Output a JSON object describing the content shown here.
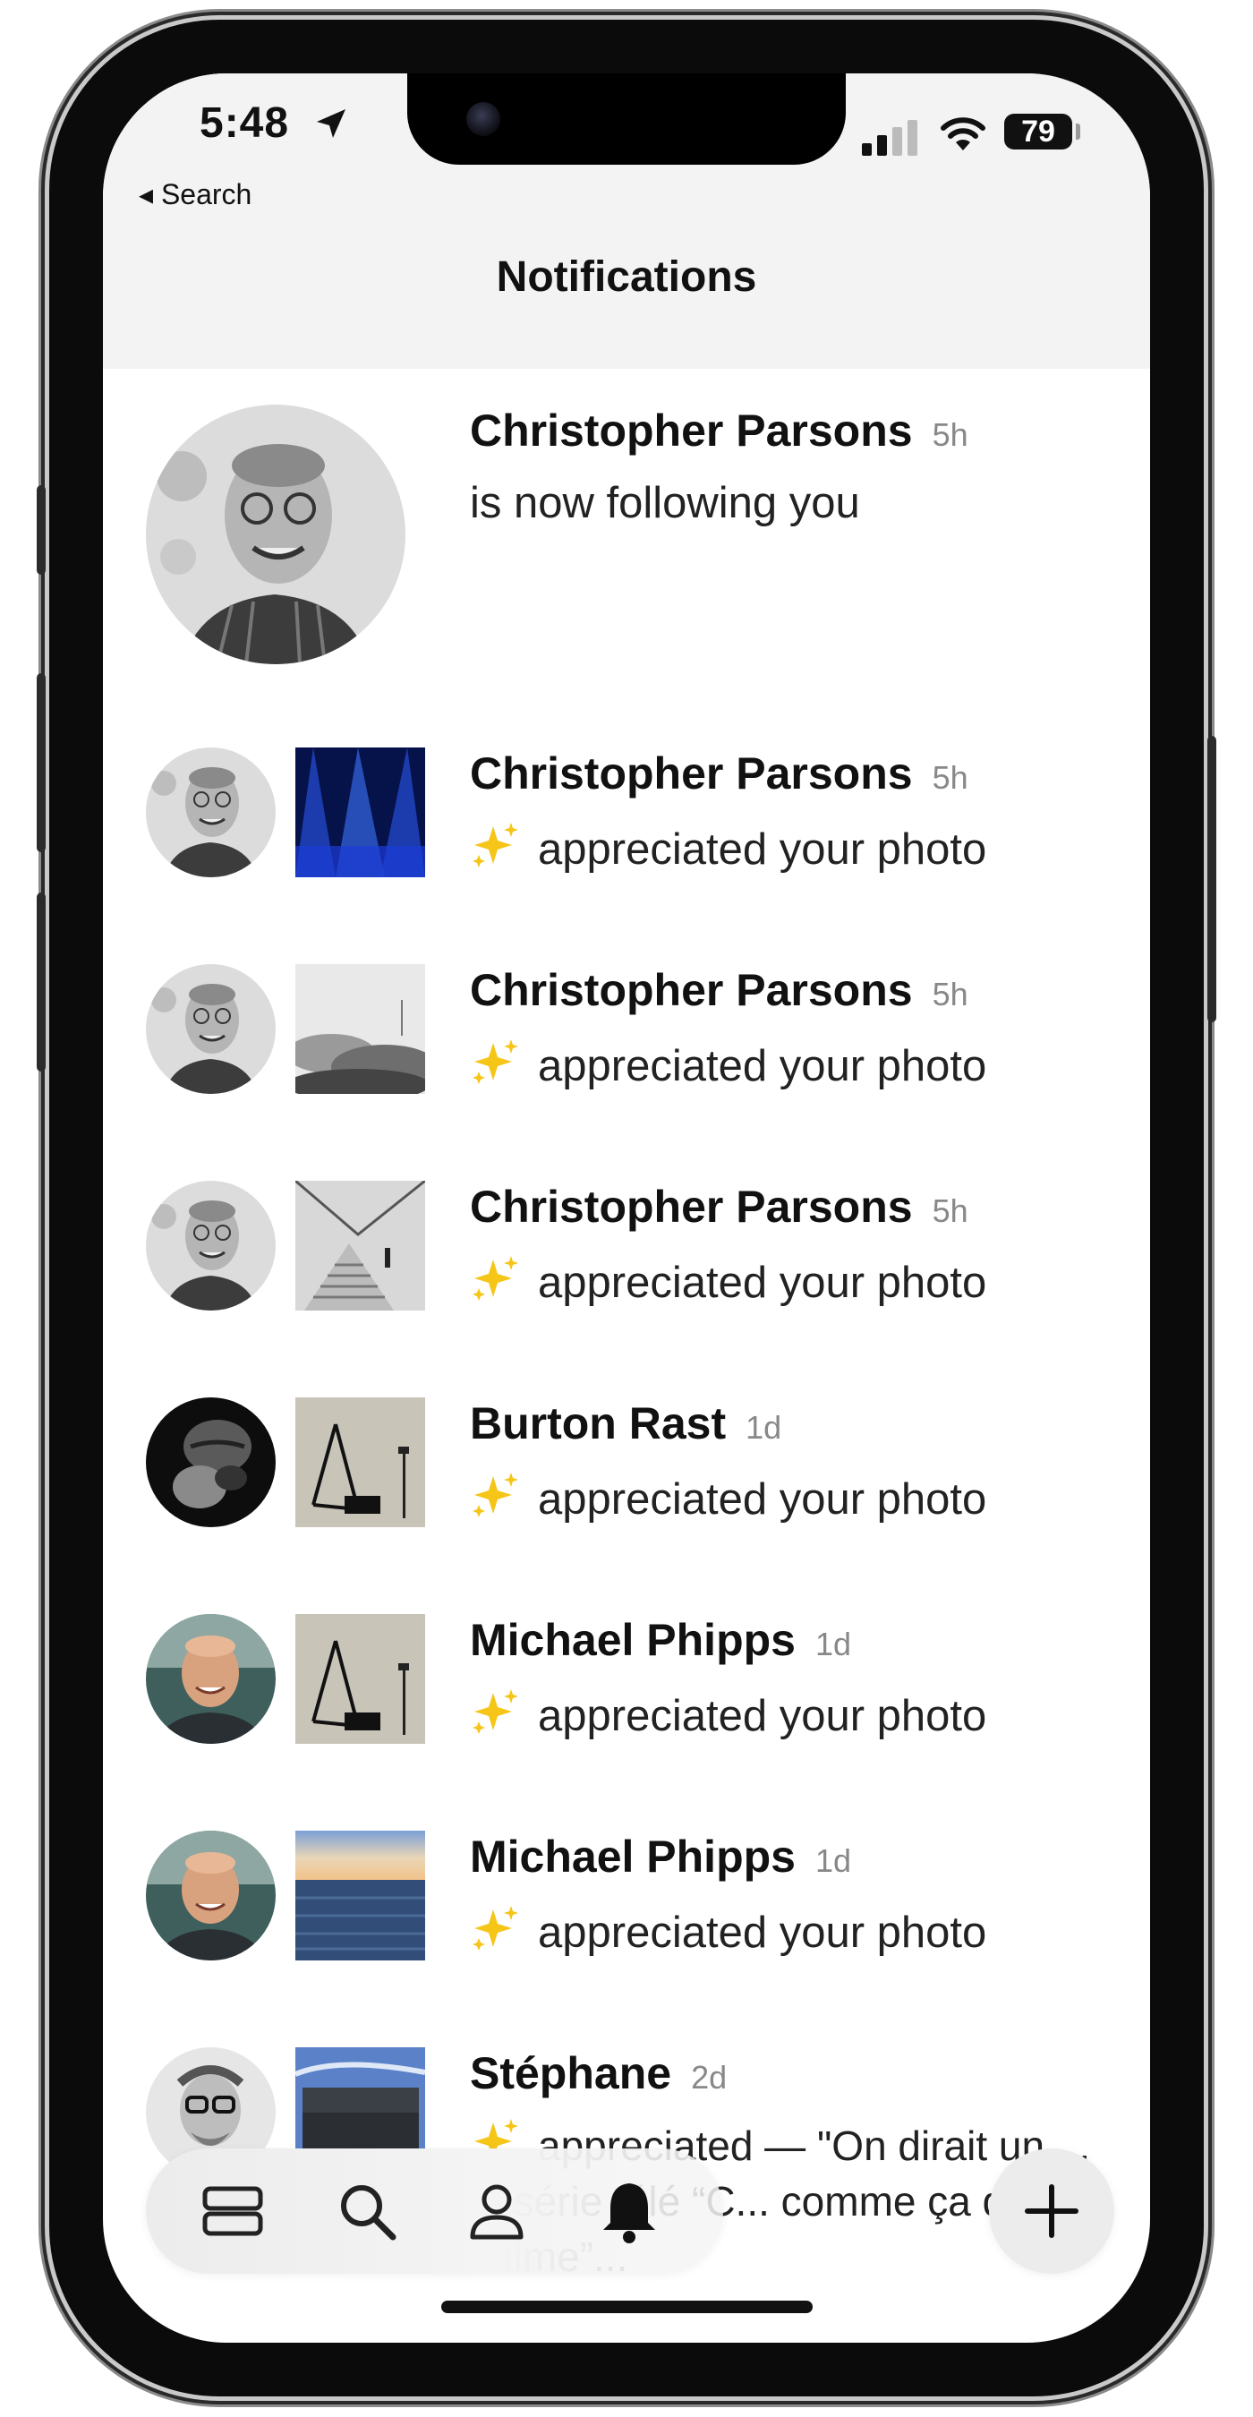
{
  "status_bar": {
    "time": "5:48",
    "back_label": "◂ Search",
    "battery": "79"
  },
  "header": {
    "title": "Notifications"
  },
  "notifications": [
    {
      "name": "Christopher Parsons",
      "ago": "5h",
      "action": "is now following you",
      "avatar": "christopher-avatar"
    },
    {
      "name": "Christopher Parsons",
      "ago": "5h",
      "action": "appreciated your photo",
      "avatar": "christopher-avatar",
      "thumbnail": "stage-lights-photo"
    },
    {
      "name": "Christopher Parsons",
      "ago": "5h",
      "action": "appreciated your photo",
      "avatar": "christopher-avatar",
      "thumbnail": "misty-clouds-photo"
    },
    {
      "name": "Christopher Parsons",
      "ago": "5h",
      "action": "appreciated your photo",
      "avatar": "christopher-avatar",
      "thumbnail": "staircase-photo"
    },
    {
      "name": "Burton Rast",
      "ago": "1d",
      "action": "appreciated your photo",
      "avatar": "burton-avatar",
      "thumbnail": "crane-photo"
    },
    {
      "name": "Michael Phipps",
      "ago": "1d",
      "action": "appreciated your photo",
      "avatar": "michael-avatar",
      "thumbnail": "crane-photo"
    },
    {
      "name": "Michael Phipps",
      "ago": "1d",
      "action": "appreciated your photo",
      "avatar": "michael-avatar",
      "thumbnail": "sea-horizon-photo"
    },
    {
      "name": "Stéphane",
      "ago": "2d",
      "action": "appreciated — \"On dirait un ... la série télé “C... comme ça que je t’aime”...",
      "avatar": "stephane-avatar",
      "thumbnail": "motel-sign-photo"
    }
  ],
  "tab_bar": {
    "tabs": [
      {
        "icon": "feed-icon"
      },
      {
        "icon": "search-icon"
      },
      {
        "icon": "profile-icon"
      },
      {
        "icon": "bell-icon",
        "active": true
      }
    ],
    "fab_icon": "plus-icon"
  },
  "colors": {
    "accent_text": "#111111",
    "muted": "#888888",
    "sparkle": "#f5c518"
  }
}
